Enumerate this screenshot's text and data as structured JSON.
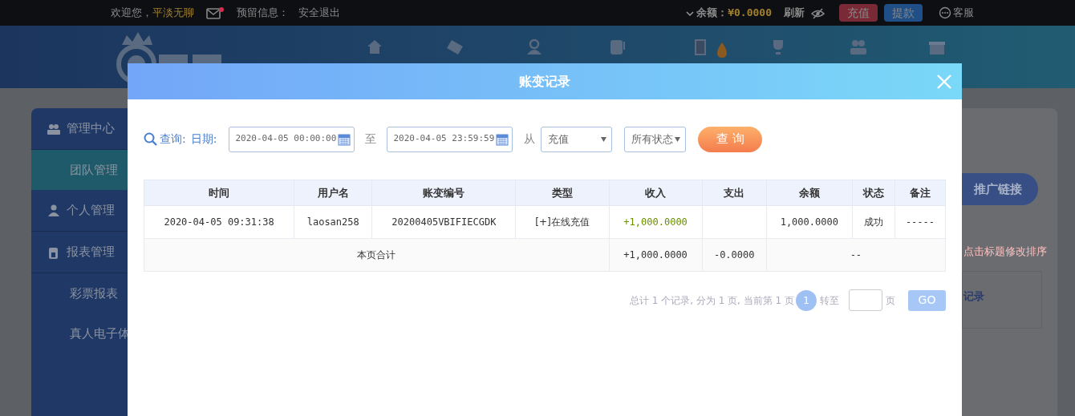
{
  "top_bar": {
    "welcome": "欢迎您，",
    "username": "平淡无聊",
    "mail_unread": true,
    "reserved_info": "预留信息：",
    "logout": "安全退出",
    "balance_label": "余额：",
    "balance": "¥0.0000",
    "refresh": "刷新",
    "deposit": "充值",
    "withdraw": "提款",
    "service": "客服"
  },
  "sidebar": {
    "items": [
      {
        "label": "管理中心",
        "kind": "group",
        "selected": false
      },
      {
        "label": "团队管理",
        "kind": "sub",
        "selected": true
      },
      {
        "label": "个人管理",
        "kind": "group",
        "selected": false
      },
      {
        "label": "报表管理",
        "kind": "group",
        "selected": false
      },
      {
        "label": "彩票报表",
        "kind": "sub",
        "selected": false
      },
      {
        "label": "真人电子体",
        "kind": "sub",
        "selected": false
      }
    ]
  },
  "right_panel": {
    "promo_button": "推广链接",
    "hint": "点击标题修改排序",
    "link": "记录"
  },
  "modal": {
    "title": "账变记录",
    "filter": {
      "query_label": "查询:",
      "date_label": "日期:",
      "start": "2020-04-05 00:00:00",
      "to": "至",
      "end": "2020-04-05 23:59:59",
      "from": "从",
      "type": "充值",
      "status": "所有状态",
      "search_button": "查 询"
    },
    "table": {
      "columns": [
        "时间",
        "用户名",
        "账变编号",
        "类型",
        "收入",
        "支出",
        "余额",
        "状态",
        "备注"
      ],
      "rows": [
        {
          "time": "2020-04-05 09:31:38",
          "username": "laosan258",
          "id": "20200405VBIFIECGDK",
          "type": "[+]在线充值",
          "income": "+1,000.0000",
          "balance": "1,000.0000",
          "status": "成功",
          "note": "-----"
        }
      ],
      "total": {
        "label": "本页合计",
        "income": "+1,000.0000",
        "expense": "-0.0000",
        "rest": "--"
      }
    },
    "pagination": {
      "summary": "总计 1 个记录, 分为 1 页, 当前第 1 页",
      "pages": [
        {
          "label": "1",
          "selected": true
        }
      ],
      "goto": "转至",
      "unit": "页",
      "go": "GO"
    }
  }
}
